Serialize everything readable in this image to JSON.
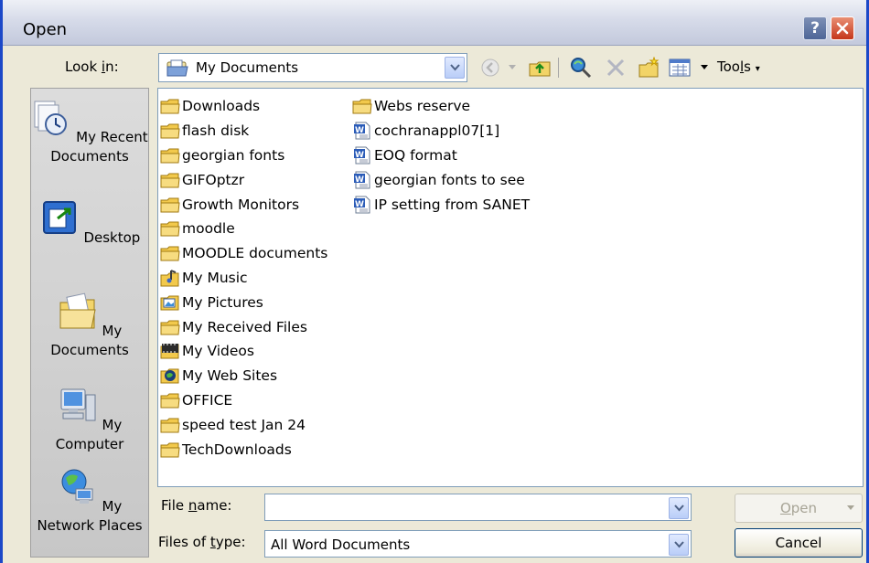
{
  "window": {
    "title": "Open"
  },
  "lookin": {
    "label_pre": "Look ",
    "label_u": "i",
    "label_post": "n:",
    "value": "My Documents"
  },
  "toolbar": {
    "tools_label_pre": "Too",
    "tools_label_u": "l",
    "tools_label_post": "s"
  },
  "places": [
    {
      "label": "My Recent Documents",
      "icon": "recent-documents-icon"
    },
    {
      "label": "Desktop",
      "icon": "desktop-icon"
    },
    {
      "label": "My Documents",
      "icon": "my-documents-icon"
    },
    {
      "label": "My Computer",
      "icon": "my-computer-icon"
    },
    {
      "label": "My Network Places",
      "icon": "network-places-icon"
    }
  ],
  "files_col1": [
    {
      "name": "Downloads",
      "icon": "folder-icon"
    },
    {
      "name": "flash disk",
      "icon": "folder-icon"
    },
    {
      "name": "georgian fonts",
      "icon": "folder-icon"
    },
    {
      "name": "GIFOptzr",
      "icon": "folder-icon"
    },
    {
      "name": "Growth Monitors",
      "icon": "folder-icon"
    },
    {
      "name": "moodle",
      "icon": "folder-icon"
    },
    {
      "name": "MOODLE documents",
      "icon": "folder-icon"
    },
    {
      "name": "My Music",
      "icon": "music-folder-icon"
    },
    {
      "name": "My Pictures",
      "icon": "pictures-folder-icon"
    },
    {
      "name": "My Received Files",
      "icon": "folder-icon"
    },
    {
      "name": "My Videos",
      "icon": "videos-folder-icon"
    },
    {
      "name": "My Web Sites",
      "icon": "websites-folder-icon"
    },
    {
      "name": "OFFICE",
      "icon": "folder-icon"
    },
    {
      "name": "speed test Jan 24",
      "icon": "folder-icon"
    },
    {
      "name": "TechDownloads",
      "icon": "folder-icon"
    }
  ],
  "files_col2": [
    {
      "name": "Webs reserve",
      "icon": "folder-icon"
    },
    {
      "name": "cochranappl07[1]",
      "icon": "word-document-icon"
    },
    {
      "name": "EOQ format",
      "icon": "word-document-icon"
    },
    {
      "name": "georgian fonts to see",
      "icon": "word-document-icon"
    },
    {
      "name": "IP setting from SANET",
      "icon": "word-document-icon"
    }
  ],
  "filename": {
    "label_pre": "File ",
    "label_u": "n",
    "label_post": "ame:",
    "value": ""
  },
  "filetype": {
    "label_pre": "Files of ",
    "label_u": "t",
    "label_post": "ype:",
    "value": "All Word Documents"
  },
  "buttons": {
    "open_u": "O",
    "open_rest": "pen",
    "cancel": "Cancel"
  }
}
